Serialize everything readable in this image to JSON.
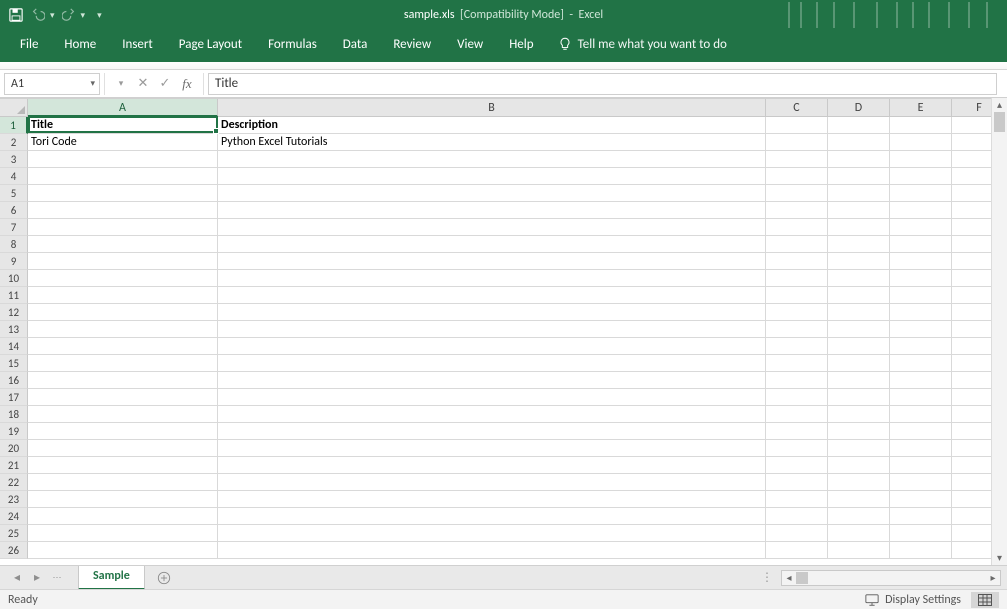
{
  "title": {
    "filename": "sample.xls",
    "mode": "[Compatibility Mode]",
    "sep": "-",
    "app": "Excel"
  },
  "ribbon": {
    "tabs": [
      "File",
      "Home",
      "Insert",
      "Page Layout",
      "Formulas",
      "Data",
      "Review",
      "View",
      "Help"
    ],
    "tell_me": "Tell me what you want to do"
  },
  "name_box": "A1",
  "formula_bar_value": "Title",
  "columns": [
    "A",
    "B",
    "C",
    "D",
    "E",
    "F"
  ],
  "row_count": 26,
  "active_cell": {
    "row": 1,
    "col": "A"
  },
  "cells": {
    "A1": "Title",
    "B1": "Description",
    "A2": "Tori Code",
    "B2": "Python Excel Tutorials"
  },
  "sheet_tab": "Sample",
  "status": {
    "left": "Ready",
    "display_settings": "Display Settings"
  },
  "colors": {
    "excel_green": "#217346"
  },
  "chart_data": null
}
